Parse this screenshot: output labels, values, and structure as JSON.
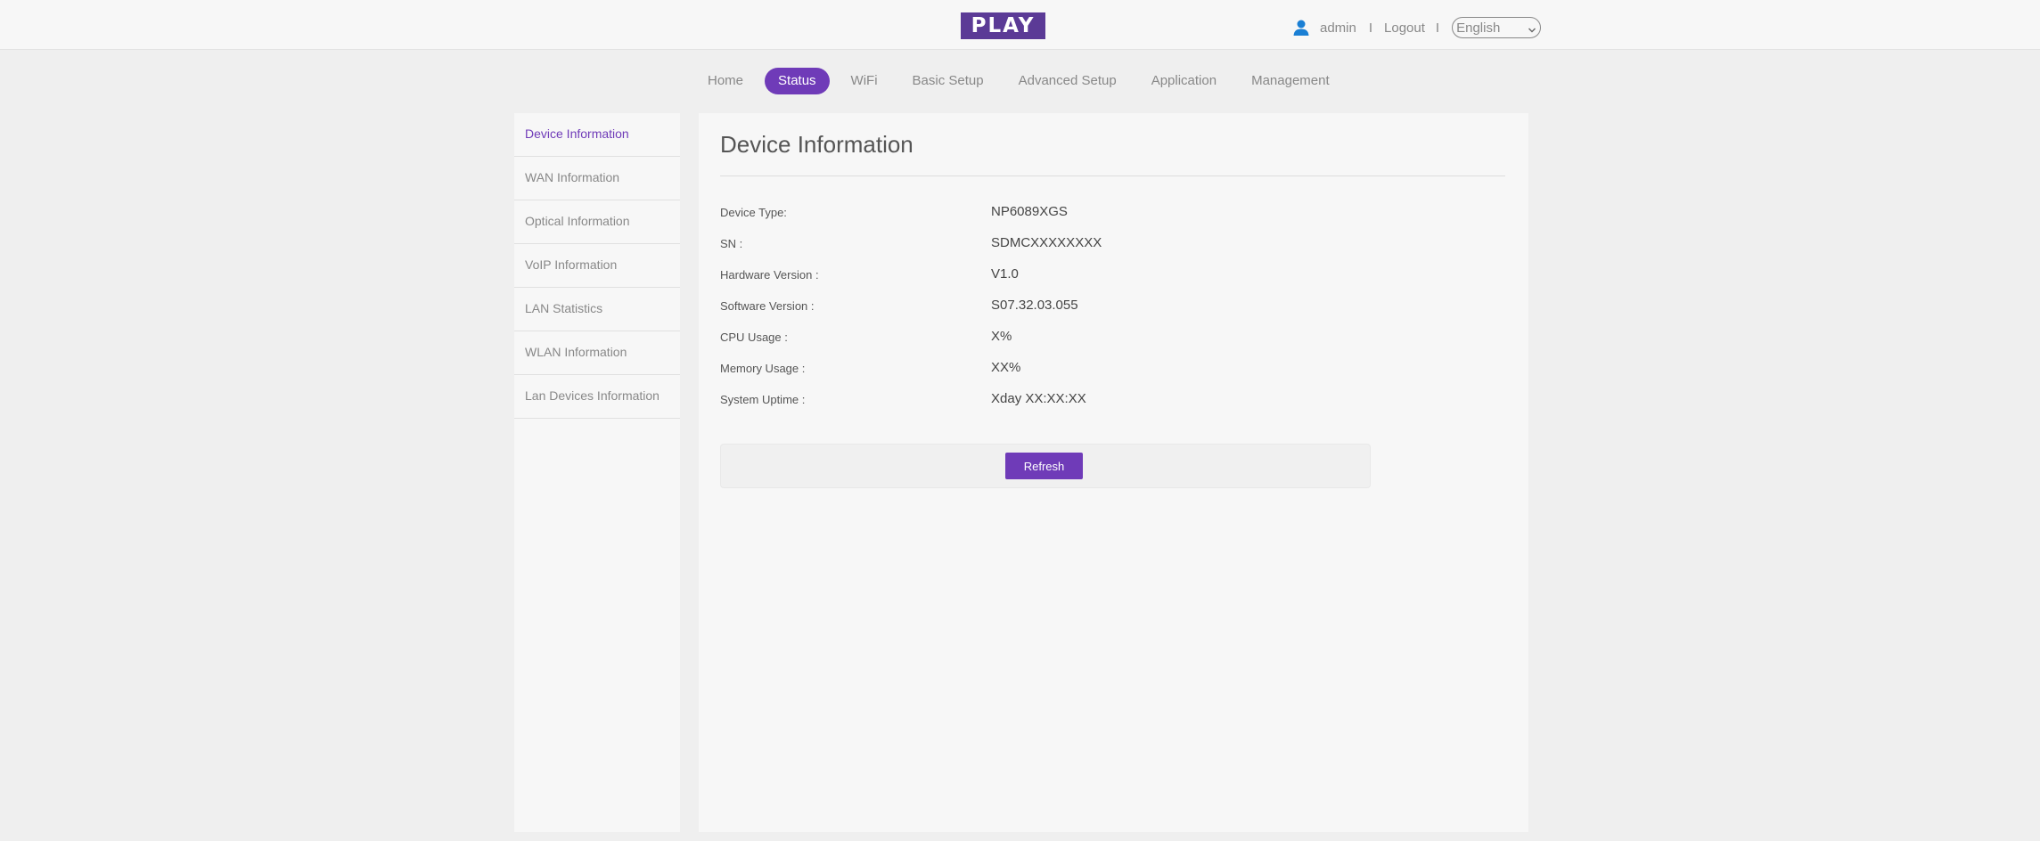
{
  "header": {
    "logo_text": "PLAY",
    "user": "admin",
    "separator": "I",
    "logout_label": "Logout",
    "language": "English",
    "brand_color": "#5b3a96",
    "user_icon_color": "#1a7fd4"
  },
  "nav": {
    "active_color": "#6f3bb8",
    "tabs": [
      {
        "label": "Home"
      },
      {
        "label": "Status",
        "active": true
      },
      {
        "label": "WiFi"
      },
      {
        "label": "Basic Setup"
      },
      {
        "label": "Advanced Setup"
      },
      {
        "label": "Application"
      },
      {
        "label": "Management"
      }
    ]
  },
  "sidebar": {
    "items": [
      {
        "label": "Device Information",
        "active": true
      },
      {
        "label": "WAN Information"
      },
      {
        "label": "Optical Information"
      },
      {
        "label": "VoIP Information"
      },
      {
        "label": "LAN Statistics"
      },
      {
        "label": "WLAN Information"
      },
      {
        "label": "Lan Devices Information"
      }
    ]
  },
  "main": {
    "title": "Device Information",
    "rows": [
      {
        "label": "Device Type:",
        "value": "NP6089XGS"
      },
      {
        "label": "SN :",
        "value": "SDMCXXXXXXXX"
      },
      {
        "label": "Hardware Version :",
        "value": "V1.0"
      },
      {
        "label": "Software Version :",
        "value": "S07.32.03.055"
      },
      {
        "label": "CPU Usage :",
        "value": "X%"
      },
      {
        "label": "Memory Usage :",
        "value": "XX%"
      },
      {
        "label": "System Uptime :",
        "value": "Xday XX:XX:XX"
      }
    ],
    "refresh_label": "Refresh"
  }
}
